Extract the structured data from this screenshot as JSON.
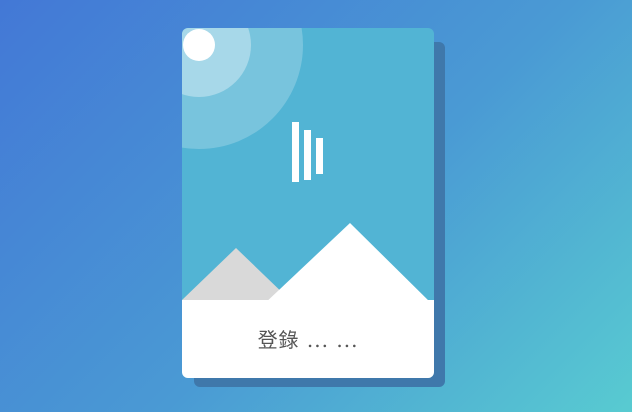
{
  "login": {
    "label": "登錄 ... ..."
  },
  "colors": {
    "background_start": "#4378d6",
    "background_end": "#58cbd1",
    "card_sky": "#52b4d4",
    "card_shadow": "#3f78ab",
    "mountain_front": "#ffffff",
    "mountain_back": "#d9d9d9",
    "logo_bars": "#ffffff"
  },
  "icons": {
    "logo": "bars-logo-icon",
    "sun": "sun-icon",
    "mountains": "mountains-icon"
  }
}
